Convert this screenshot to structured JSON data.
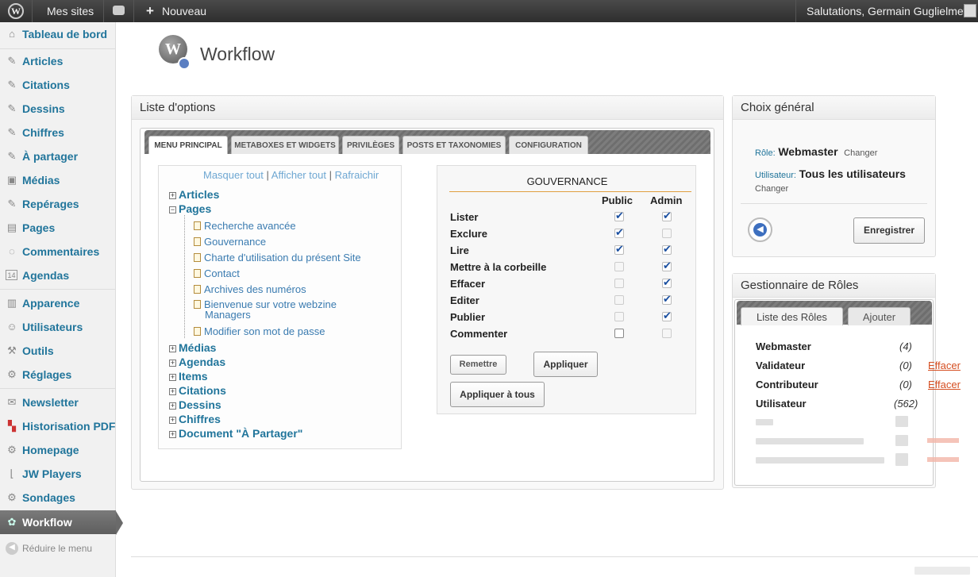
{
  "adminbar": {
    "my_sites": "Mes sites",
    "new": "Nouveau",
    "greeting": "Salutations, Germain Guglielmetti"
  },
  "sidebar": {
    "items": [
      {
        "label": "Tableau de bord",
        "icon": "dashboard-icon"
      },
      {
        "label": "Articles",
        "icon": "pin-icon"
      },
      {
        "label": "Citations",
        "icon": "pin-icon"
      },
      {
        "label": "Dessins",
        "icon": "pin-icon"
      },
      {
        "label": "Chiffres",
        "icon": "pin-icon"
      },
      {
        "label": "À partager",
        "icon": "pin-icon"
      },
      {
        "label": "Médias",
        "icon": "media-icon"
      },
      {
        "label": "Repérages",
        "icon": "pin-icon"
      },
      {
        "label": "Pages",
        "icon": "pages-icon"
      },
      {
        "label": "Commentaires",
        "icon": "comment-icon"
      },
      {
        "label": "Agendas",
        "icon": "calendar-icon"
      },
      {
        "label": "Apparence",
        "icon": "appearance-icon"
      },
      {
        "label": "Utilisateurs",
        "icon": "users-icon"
      },
      {
        "label": "Outils",
        "icon": "tools-icon"
      },
      {
        "label": "Réglages",
        "icon": "settings-icon"
      },
      {
        "label": "Newsletter",
        "icon": "mail-icon"
      },
      {
        "label": "Historisation PDF",
        "icon": "pdf-icon"
      },
      {
        "label": "Homepage",
        "icon": "gear-icon"
      },
      {
        "label": "JW Players",
        "icon": "chart-icon"
      },
      {
        "label": "Sondages",
        "icon": "gear-icon"
      },
      {
        "label": "Workflow",
        "icon": "workflow-icon"
      }
    ],
    "calendar_day": "14",
    "collapse": "Réduire le menu"
  },
  "page": {
    "title": "Workflow"
  },
  "options": {
    "title": "Liste d'options",
    "tabs": [
      "MENU PRINCIPAL",
      "METABOXES ET WIDGETS",
      "PRIVILÈGES",
      "POSTS ET TAXONOMIES",
      "CONFIGURATION"
    ],
    "links": {
      "hide": "Masquer tout",
      "show": "Afficher tout",
      "refresh": "Rafraichir",
      "sep": "|"
    },
    "tree": {
      "articles": "Articles",
      "pages": "Pages",
      "page_children": [
        "Recherche avancée",
        "Gouvernance",
        "Charte d'utilisation du présent Site",
        "Contact",
        "Archives des numéros",
        "Bienvenue sur votre webzine",
        "Managers",
        "Modifier son mot de passe"
      ],
      "others": [
        "Médias",
        "Agendas",
        "Items",
        "Citations",
        "Dessins",
        "Chiffres",
        "Document \"À Partager\""
      ]
    },
    "governance": {
      "title": "GOUVERNANCE",
      "col_public": "Public",
      "col_admin": "Admin",
      "rows": [
        {
          "label": "Lister",
          "public": true,
          "admin": true
        },
        {
          "label": "Exclure",
          "public": true,
          "admin": false
        },
        {
          "label": "Lire",
          "public": true,
          "admin": true
        },
        {
          "label": "Mettre à la corbeille",
          "public": false,
          "admin": true
        },
        {
          "label": "Effacer",
          "public": false,
          "admin": true
        },
        {
          "label": "Editer",
          "public": false,
          "admin": true
        },
        {
          "label": "Publier",
          "public": false,
          "admin": true
        },
        {
          "label": "Commenter",
          "public": false,
          "admin": false
        }
      ],
      "reset": "Remettre",
      "apply": "Appliquer",
      "apply_all": "Appliquer à tous"
    }
  },
  "general": {
    "title": "Choix général",
    "role_label": "Rôle:",
    "role_value": "Webmaster",
    "change": "Changer",
    "user_label": "Utilisateur:",
    "user_value": "Tous les utilisateurs",
    "save": "Enregistrer"
  },
  "roles": {
    "title": "Gestionnaire de Rôles",
    "tabs": [
      "Liste des Rôles",
      "Ajouter"
    ],
    "items": [
      {
        "name": "Webmaster",
        "count": "(4)",
        "action": ""
      },
      {
        "name": "Validateur",
        "count": "(0)",
        "action": "Effacer"
      },
      {
        "name": "Contributeur",
        "count": "(0)",
        "action": "Effacer"
      },
      {
        "name": "Utilisateur",
        "count": "(562)",
        "action": ""
      }
    ]
  }
}
